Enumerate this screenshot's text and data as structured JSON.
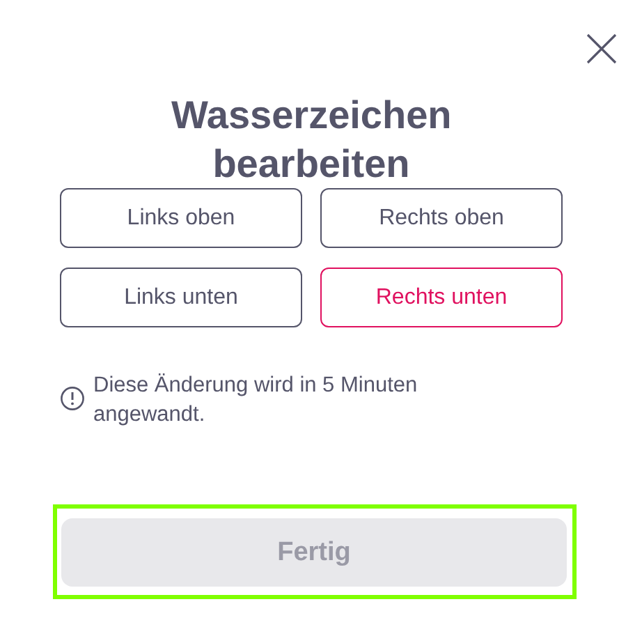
{
  "title": "Wasserzeichen bearbeiten",
  "positions": [
    {
      "label": "Links oben",
      "selected": false
    },
    {
      "label": "Rechts oben",
      "selected": false
    },
    {
      "label": "Links unten",
      "selected": false
    },
    {
      "label": "Rechts unten",
      "selected": true
    }
  ],
  "note": "Diese Änderung wird in 5 Minuten angewandt.",
  "done_button": {
    "label": "Fertig",
    "disabled": true,
    "focused": true
  }
}
